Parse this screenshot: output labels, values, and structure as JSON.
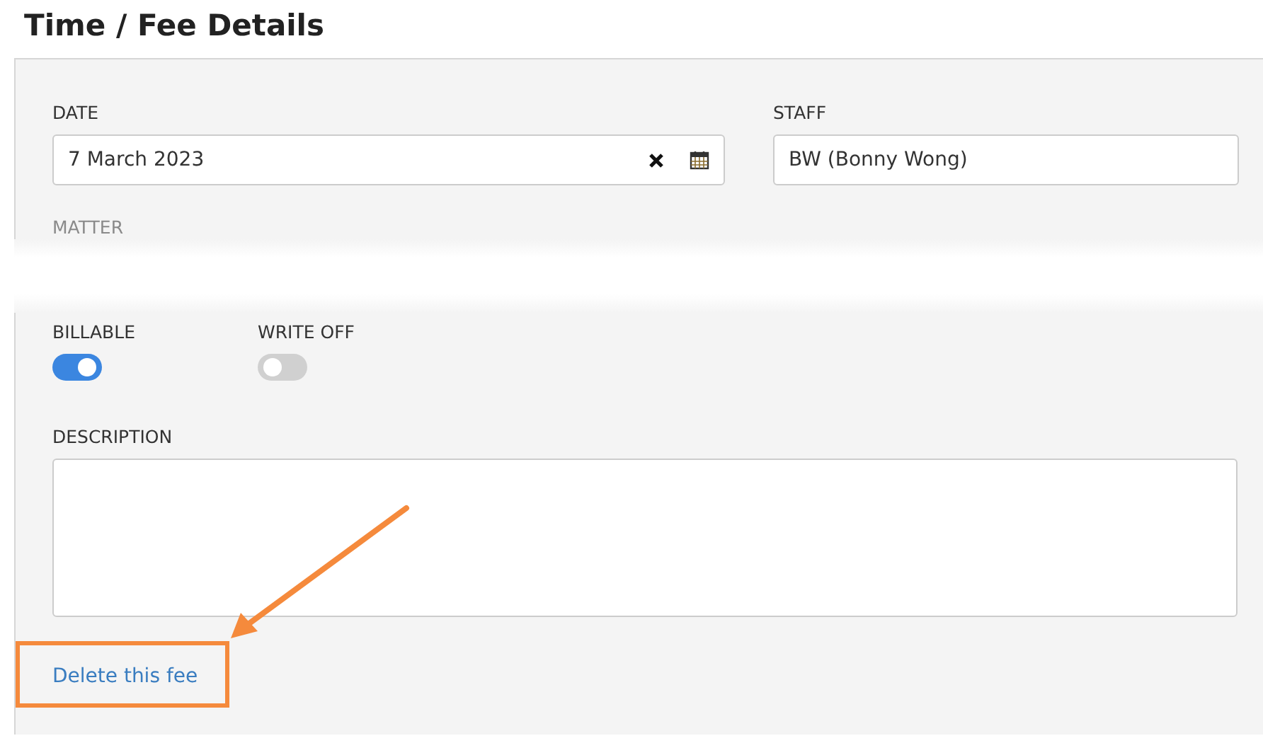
{
  "title": "Time / Fee Details",
  "date": {
    "label": "DATE",
    "value": "7 March 2023"
  },
  "staff": {
    "label": "STAFF",
    "value": "BW (Bonny Wong)"
  },
  "matter": {
    "label": "MATTER"
  },
  "toggles": [
    {
      "label": "BILLABLE",
      "on": true
    },
    {
      "label": "WRITE OFF",
      "on": false
    }
  ],
  "description": {
    "label": "DESCRIPTION"
  },
  "delete_link": "Delete this fee"
}
